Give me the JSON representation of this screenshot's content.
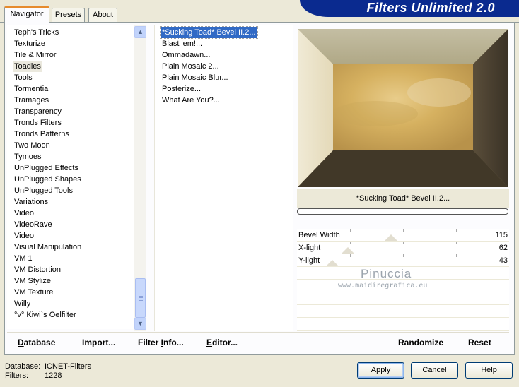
{
  "window": {
    "title": "Filters Unlimited 2.0",
    "brand_color": "#0a2a8f"
  },
  "tabs": [
    {
      "label": "Navigator",
      "active": true
    },
    {
      "label": "Presets",
      "active": false
    },
    {
      "label": "About",
      "active": false
    }
  ],
  "categories": {
    "items": [
      "Teph's Tricks",
      "Texturize",
      "Tile & Mirror",
      "Toadies",
      "Tools",
      "Tormentia",
      "Tramages",
      "Transparency",
      "Tronds Filters",
      "Tronds Patterns",
      "Two Moon",
      "Tymoes",
      "UnPlugged Effects",
      "UnPlugged Shapes",
      "UnPlugged Tools",
      "Variations",
      "Video",
      "VideoRave",
      "Video",
      "Visual Manipulation",
      "VM 1",
      "VM Distortion",
      "VM Stylize",
      "VM Texture",
      "Willy",
      "°v° Kiwi`s Oelfilter"
    ],
    "selected": "Toadies"
  },
  "scrollbar": {
    "up_icon": "▲",
    "down_icon": "▼"
  },
  "filters": {
    "items": [
      "*Sucking Toad*  Bevel II.2...",
      "Blast 'em!...",
      "Ommadawn...",
      "Plain Mosaic 2...",
      "Plain Mosaic Blur...",
      "Posterize...",
      "What Are You?..."
    ],
    "selected": "*Sucking Toad*  Bevel II.2..."
  },
  "preview": {
    "filter_name": "*Sucking Toad*  Bevel II.2..."
  },
  "sliders": [
    {
      "label": "Bevel Width",
      "value": "115"
    },
    {
      "label": "X-light",
      "value": "62"
    },
    {
      "label": "Y-light",
      "value": "43"
    }
  ],
  "watermark": {
    "line1": "Pinuccia",
    "line2": "www.maidiregrafica.eu"
  },
  "toolbar": {
    "database": {
      "first": "D",
      "rest": "atabase"
    },
    "import": {
      "pre": "Import",
      "rest": "..."
    },
    "filter_info": {
      "pre": "Filter ",
      "u": "I",
      "rest": "nfo..."
    },
    "editor": {
      "first": "E",
      "rest": "ditor..."
    },
    "randomize": "Randomize",
    "reset": "Reset"
  },
  "status": {
    "database_label": "Database:",
    "database_value": "ICNET-Filters",
    "filters_label": "Filters:",
    "filters_value": "1228"
  },
  "buttons": {
    "apply": "Apply",
    "cancel": "Cancel",
    "help": "Help"
  }
}
